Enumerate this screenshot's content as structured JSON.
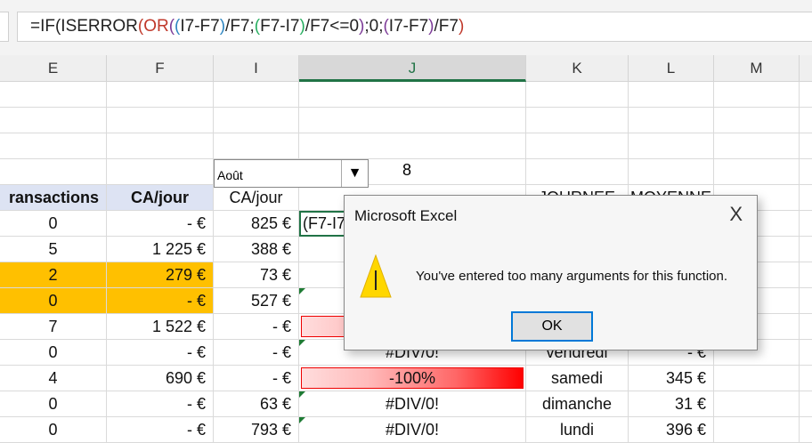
{
  "formula_bar": {
    "parts": [
      "=IF(ISERROR",
      "(",
      "OR",
      "(",
      "(",
      "I7-F7",
      ")",
      "/F7;",
      "(",
      "F7-I7",
      ")",
      "/F7<=0",
      ")",
      ";0;",
      "(",
      "I7-F7",
      ")",
      "/F7",
      ")"
    ]
  },
  "columns": [
    "E",
    "F",
    "I",
    "J",
    "K",
    "L",
    "M"
  ],
  "dropdown": {
    "value": "Août",
    "arrow": "▼"
  },
  "month_number": "8",
  "headers": {
    "e": "ransactions",
    "f": "CA/jour",
    "i": "CA/jour",
    "k": "JOURNEE",
    "l": "MOYENNE"
  },
  "rows": [
    {
      "e": "0",
      "f": "-    €",
      "i": "825 €",
      "j": "(F7-I7",
      "k": "",
      "l": ""
    },
    {
      "e": "5",
      "f": "1 225 €",
      "i": "388 €",
      "j": "",
      "k": "",
      "l": ""
    },
    {
      "e": "2",
      "f": "279 €",
      "i": "73 €",
      "j": "",
      "k": "",
      "l": ""
    },
    {
      "e": "0",
      "f": "-    €",
      "i": "527 €",
      "j": "",
      "k": "",
      "l": ""
    },
    {
      "e": "7",
      "f": "1 522 €",
      "i": "-    €",
      "j": "",
      "k": "",
      "l": ""
    },
    {
      "e": "0",
      "f": "-    €",
      "i": "-    €",
      "j": "#DIV/0!",
      "k": "vendredi",
      "l": "-    €"
    },
    {
      "e": "4",
      "f": "690 €",
      "i": "-    €",
      "j": "-100%",
      "k": "samedi",
      "l": "345 €"
    },
    {
      "e": "0",
      "f": "-    €",
      "i": "63 €",
      "j": "#DIV/0!",
      "k": "dimanche",
      "l": "31 €"
    },
    {
      "e": "0",
      "f": "-    €",
      "i": "793 €",
      "j": "#DIV/0!",
      "k": "lundi",
      "l": "396 €"
    }
  ],
  "dialog": {
    "title": "Microsoft Excel",
    "close": "X",
    "message": "You've entered too many arguments for this function.",
    "ok": "OK"
  }
}
